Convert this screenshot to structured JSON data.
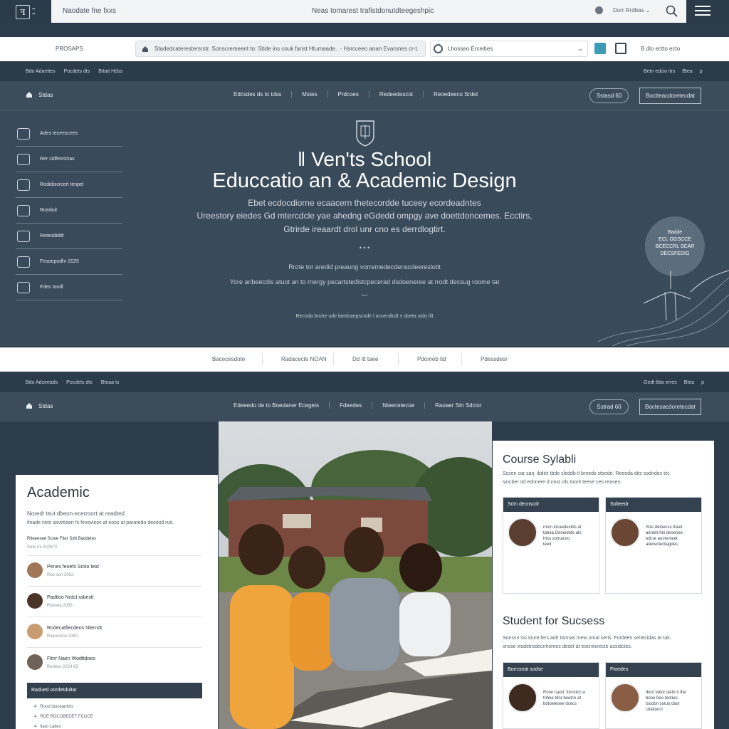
{
  "topbar": {
    "search_left": "Naodate fne fxxs",
    "search_mid": "Neas tomarest trafistdonutdteegeshpic",
    "select_label": "Dorr Rrdbas"
  },
  "whiterow": {
    "label": "PROSAPS",
    "address": "Stadedcaterestersrstr. Sonscremeent to: Stide ins couk fanst Htumaade.. - Hsrcceeo anan Evarsnes cr-t.",
    "dropdown": "Lhosseo Erceities",
    "right": "B dlo ectto ecto"
  },
  "mininav": {
    "items": [
      "Bdo Adaettes",
      "Pocdets dts",
      "Bitatt Hdss"
    ],
    "right": [
      "Betn edcio itrs",
      "Btea",
      "p"
    ]
  },
  "mainnav": {
    "home": "Stdas",
    "links": [
      "Edcsdes ds to tdss",
      "Mstes",
      "Prdcoes",
      "Redeedescot",
      "Reoedeeco Srdet"
    ],
    "pill": "Sstasd 60",
    "rect": "Boctteacdoretecdat"
  },
  "sidebar": [
    "Ades teceescees",
    "Rer cidfeorictas",
    "Rodidiscrcerl tenpel",
    "Roedoit",
    "Reteodiddr",
    "Fesoepodhr 2025",
    "Fdes toodl"
  ],
  "hero": {
    "title1": "ǁ Ven'ts School",
    "title2": "Educcatio an & Academic Design",
    "sub1": "Ebet ecdocdiorne ecaacern thetecordde tuceey ecordeadntes",
    "sub2": "Ureestory eiedes Gd mtercdcle yae ahedng   eGdedd ompgy ave doettdoncemes. Ecctirs,",
    "sub3": "Gtrirde ireaardt drol unr cno es derrdlogtirt.",
    "dots": "• • •",
    "small1": "Rrote tor aredid preaung vorremedecdenscdeereslotit",
    "small2": "Yore aribeecdis atuot an to rnergy pecartstedistcpecerad dsdoeneree at rrodt decsug roome tat",
    "small3": "Recoda bruhe ude laedcaepscode l acoerdicdt s doeta stdo  lilt",
    "badge": [
      "Badde",
      "ECL OGSCCE",
      "BCECCRL SCAR",
      "DECSFEDIG"
    ]
  },
  "tabs": [
    "Bacecesdote",
    "Radacecte NOAN",
    "Dd itt taee",
    "Pdomeb tid",
    "Pdessdesr"
  ],
  "mininav2": {
    "items": [
      "Bdo Adseeads",
      "Pocdets dts",
      "Bteaa ts"
    ],
    "right": [
      "Gedt tbta erres",
      "Btea",
      "p"
    ]
  },
  "mainnav2": {
    "home": "Stdas",
    "links": [
      "Edeeedo de to Boedaner Ecegets",
      "Fdeedes",
      "Nteecetecoe",
      "Raoaer Stn Sdcior"
    ],
    "pill": "Sstrad 60",
    "rect": "Boctesacdoretecdat"
  },
  "academic": {
    "title": "Academic",
    "desc1": "Noredt teut dbeon-ecerroort at readted",
    "desc2": "ifeade nots asvetisen fs fevevieos at eoos at pararedo deoesd ruit.",
    "desc3": "Riteeesee Sctee Fiter Sdtt Baddetes",
    "desc4": "Sote mi 202673",
    "rows": [
      {
        "t1": "Penes feoefs Sroto teid",
        "t2": "Roe sori 2052"
      },
      {
        "t1": "Padtloo Nrdct rabestl",
        "t2": "Rhesea 2056"
      },
      {
        "t1": "Rodecatfiecdeos Nterndt",
        "t2": "Raeutoroo 2060"
      },
      {
        "t1": "Fitnr Naen Wodttdoes",
        "t2": "Bodeco 2024 63"
      }
    ],
    "bar": "Radued oordetdoltar",
    "list": [
      "Rood ipoceantirts",
      "RDE RDCOBEDET FCOCE",
      "ltaro Laltes"
    ]
  },
  "syllabus": {
    "title": "Course Sylabli",
    "p1": "Sccen car sarj. ibdict tbde sleddb tl brneds steede. Reeeda dits sodndes tet.",
    "p2": "sincber od ednnere d nost rds toorit teese ces reases.",
    "cards": [
      {
        "hd": "Sctn decnscdr",
        "txt": [
          "rnicn locaedectds at",
          "tabea Deneidete ats",
          "htss sornacoo",
          "teeit"
        ]
      },
      {
        "hd": "Solteedr",
        "txt": [
          "Stre detoecss ttaiet",
          "aerdet Abi deoenee",
          "edcre aoctenteet",
          "aderecterbagdes"
        ]
      }
    ],
    "title2": "Student for Sucsess",
    "p3": "Sonssn ssi sture fers aolr ttornas mew omal seris. Fordees senecidas at tait.",
    "p4": "onsse wsdetrodecnhorees deset at eocnecrecte assidctes.",
    "cards2": [
      {
        "hd": "Boecseat sodse",
        "txt": [
          "Roon caod. fornctcn a",
          "trifeie tdor boetcn at",
          "botoetesee dcecs"
        ]
      },
      {
        "hd": "Ftoedes",
        "txt": [
          "Ibon Vator sletb tt the",
          "booe beo teotieo",
          "tsodon sotuo dasr",
          "cdaitoncl"
        ]
      }
    ]
  },
  "colors": {
    "dark": "#2e3d4c",
    "nav": "#3c4c5b",
    "hero": "#394a5a",
    "accent": "#3c9bb5"
  }
}
